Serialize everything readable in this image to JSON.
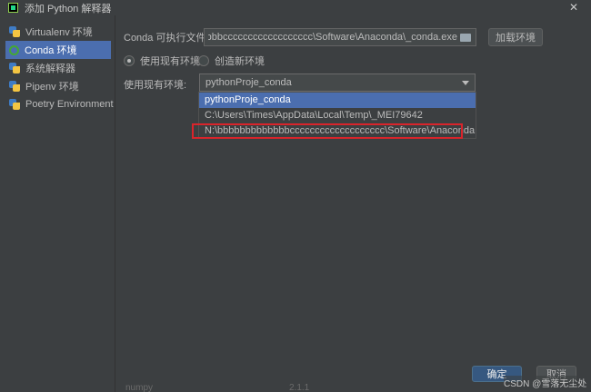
{
  "window": {
    "title": "添加 Python 解释器"
  },
  "sidebar": {
    "items": [
      {
        "label": "Virtualenv 环境"
      },
      {
        "label": "Conda 环境"
      },
      {
        "label": "系统解释器"
      },
      {
        "label": "Pipenv 环境"
      },
      {
        "label": "Poetry Environment"
      }
    ]
  },
  "conda": {
    "exe_label": "Conda 可执行文件:",
    "exe_value": "bbbbbbbbbbcccccccccccccccccc\\Software\\Anaconda\\_conda.exe",
    "load_button": "加载环境"
  },
  "env_mode": {
    "existing_label": "使用现有环境",
    "new_label": "创造新环境"
  },
  "existing_env": {
    "label": "使用现有环境:",
    "selected": "pythonProje_conda",
    "options": [
      "pythonProje_conda",
      "C:\\Users\\Times\\AppData\\Local\\Temp\\_MEI79642",
      "N:\\bbbbbbbbbbbbbccccccccccccccccccc\\Software\\Anaconda"
    ]
  },
  "footer": {
    "ok": "确定",
    "cancel": "取消",
    "watermark": "CSDN @雪落无尘处",
    "bg_left": "numpy",
    "bg_mid": "2.1.1"
  },
  "colors": {
    "accent": "#4b6eaf",
    "highlight": "#d9242b",
    "background": "#3c3f41"
  }
}
